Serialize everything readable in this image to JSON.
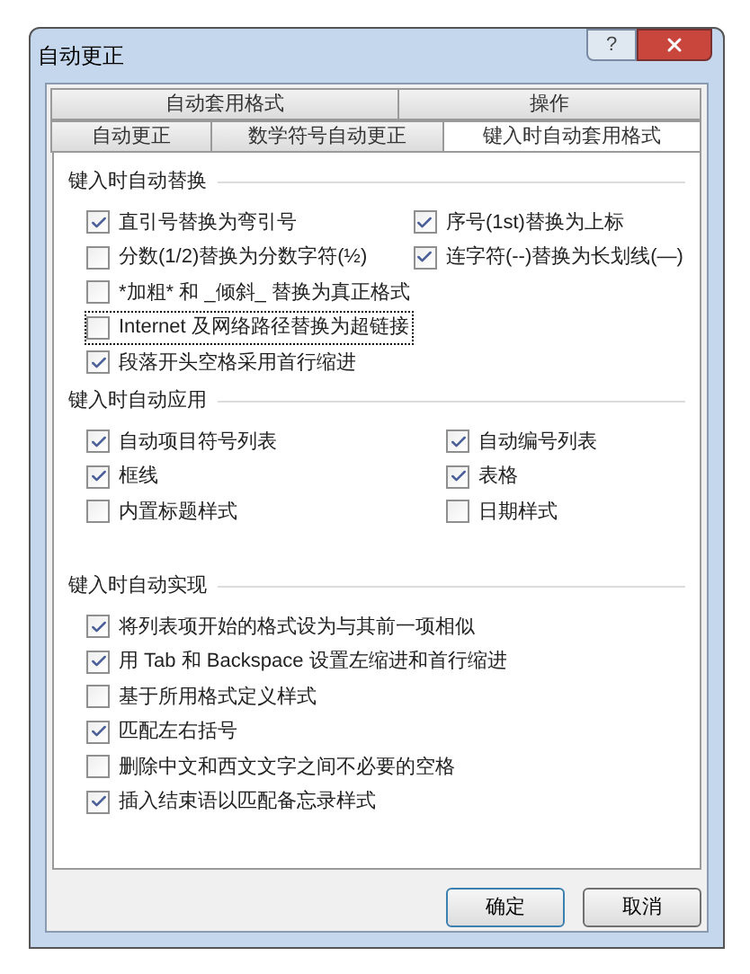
{
  "window": {
    "title": "自动更正",
    "help_button": "?"
  },
  "tab_rows": [
    [
      {
        "label": "自动套用格式",
        "selected": false
      },
      {
        "label": "操作",
        "selected": false
      }
    ],
    [
      {
        "label": "自动更正",
        "selected": false
      },
      {
        "label": "数学符号自动更正",
        "selected": false
      },
      {
        "label": "键入时自动套用格式",
        "selected": true
      }
    ]
  ],
  "sections": [
    {
      "title": "键入时自动替换",
      "left": [
        {
          "label": "直引号替换为弯引号",
          "checked": true,
          "focused": false
        },
        {
          "label": "分数(1/2)替换为分数字符(½)",
          "checked": false,
          "focused": false
        },
        {
          "label": "*加粗* 和 _倾斜_ 替换为真正格式",
          "checked": false,
          "focused": false
        },
        {
          "label": "Internet 及网络路径替换为超链接",
          "checked": false,
          "focused": true
        },
        {
          "label": "段落开头空格采用首行缩进",
          "checked": true,
          "focused": false
        }
      ],
      "right": [
        {
          "label": "序号(1st)替换为上标",
          "checked": true,
          "focused": false
        },
        {
          "label": "连字符(--)替换为长划线(—)",
          "checked": true,
          "focused": false
        }
      ]
    },
    {
      "title": "键入时自动应用",
      "left": [
        {
          "label": "自动项目符号列表",
          "checked": true
        },
        {
          "label": "框线",
          "checked": true
        },
        {
          "label": "内置标题样式",
          "checked": false
        }
      ],
      "right": [
        {
          "label": "自动编号列表",
          "checked": true
        },
        {
          "label": "表格",
          "checked": true
        },
        {
          "label": "日期样式",
          "checked": false
        }
      ]
    },
    {
      "title": "键入时自动实现",
      "left": [
        {
          "label": "将列表项开始的格式设为与其前一项相似",
          "checked": true
        },
        {
          "label": "用 Tab 和 Backspace 设置左缩进和首行缩进",
          "checked": true
        },
        {
          "label": "基于所用格式定义样式",
          "checked": false
        },
        {
          "label": "匹配左右括号",
          "checked": true
        },
        {
          "label": "删除中文和西文文字之间不必要的空格",
          "checked": false
        },
        {
          "label": "插入结束语以匹配备忘录样式",
          "checked": true
        }
      ]
    }
  ],
  "buttons": [
    "确定",
    "取消"
  ]
}
